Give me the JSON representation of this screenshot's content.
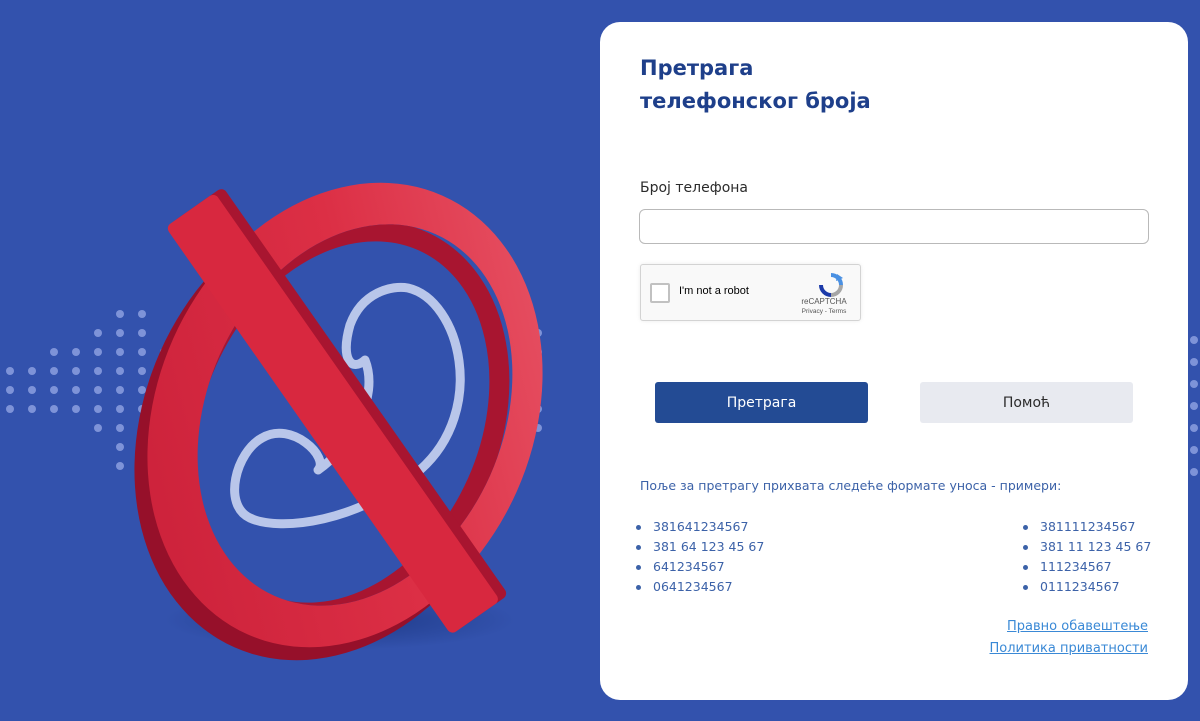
{
  "title": {
    "line1": "Претрага",
    "line2": "телефонског броја"
  },
  "form": {
    "phone_label": "Број телефона",
    "phone_value": "",
    "phone_placeholder": ""
  },
  "recaptcha": {
    "label": "I'm not a robot",
    "brand": "reCAPTCHA",
    "links": "Privacy - Terms",
    "checked": false
  },
  "buttons": {
    "search": "Претрага",
    "help": "Помоћ"
  },
  "hint": "Поље за претрагу прихвата следеће формате уноса - примери:",
  "examples_left": [
    "381641234567",
    "381 64 123 45 67",
    "641234567",
    "0641234567"
  ],
  "examples_right": [
    "381111234567",
    "381 11 123 45 67",
    "111234567",
    "0111234567"
  ],
  "links": {
    "legal": "Правно обавештење",
    "privacy": "Политика приватности"
  },
  "illustration": {
    "icon": "phone-blocked-icon",
    "background_color": "#3352ad",
    "sign_color": "#dc2f45",
    "handset_color": "#b9c6ea"
  },
  "colors": {
    "title": "#1e3f8a",
    "primary_button": "#234b94",
    "secondary_button": "#e8eaf0",
    "link": "#3a89d6",
    "hint_text": "#3c62a8"
  }
}
